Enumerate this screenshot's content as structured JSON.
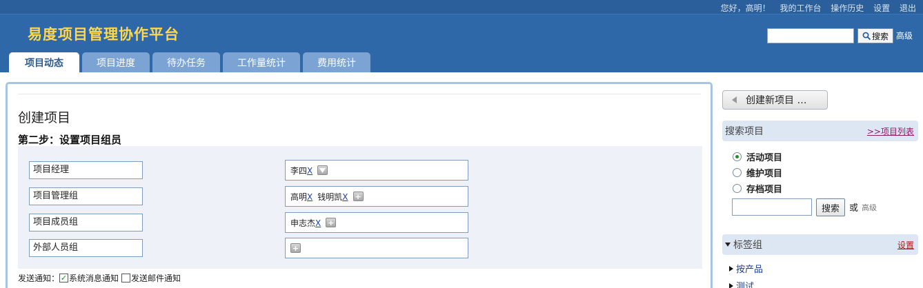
{
  "header": {
    "greeting": "您好，高明！",
    "links": [
      "我的工作台",
      "操作历史",
      "设置",
      "退出"
    ],
    "brand": "易度项目管理协作平台",
    "search_button": "搜索",
    "advanced": "高级"
  },
  "tabs": [
    {
      "label": "项目动态",
      "active": true
    },
    {
      "label": "项目进度",
      "active": false
    },
    {
      "label": "待办任务",
      "active": false
    },
    {
      "label": "工作量统计",
      "active": false
    },
    {
      "label": "费用统计",
      "active": false
    }
  ],
  "main": {
    "title": "创建项目",
    "step": "第二步：设置项目组员",
    "roles": [
      {
        "label": "项目经理",
        "members": [
          "李四"
        ],
        "control": "dropdown"
      },
      {
        "label": "项目管理组",
        "members": [
          "高明",
          "钱明凯"
        ],
        "control": "add"
      },
      {
        "label": "项目成员组",
        "members": [
          "申志杰"
        ],
        "control": "add"
      },
      {
        "label": "外部人员组",
        "members": [],
        "control": "add"
      }
    ],
    "remove_mark": "X",
    "notify": {
      "label": "发送通知：",
      "system": {
        "label": "系统消息通知",
        "checked": true
      },
      "email": {
        "label": "发送邮件通知",
        "checked": false
      }
    }
  },
  "sidebar": {
    "create_button": "创建新项目 …",
    "search_section": {
      "title": "搜索项目",
      "link": ">>项目列表",
      "options": [
        {
          "label": "活动项目",
          "selected": true
        },
        {
          "label": "维护项目",
          "selected": false
        },
        {
          "label": "存档项目",
          "selected": false
        }
      ],
      "search_button": "搜索",
      "or": "或",
      "advanced": "高级"
    },
    "tags_section": {
      "title": "标签组",
      "link": "设置",
      "items": [
        "按产品",
        "测试"
      ]
    }
  },
  "colors": {
    "header_bg": "#2f68a8",
    "brand_text": "#ffd84a",
    "tab_bg": "#7ba3d3",
    "panel_border": "#a8c4e3"
  }
}
